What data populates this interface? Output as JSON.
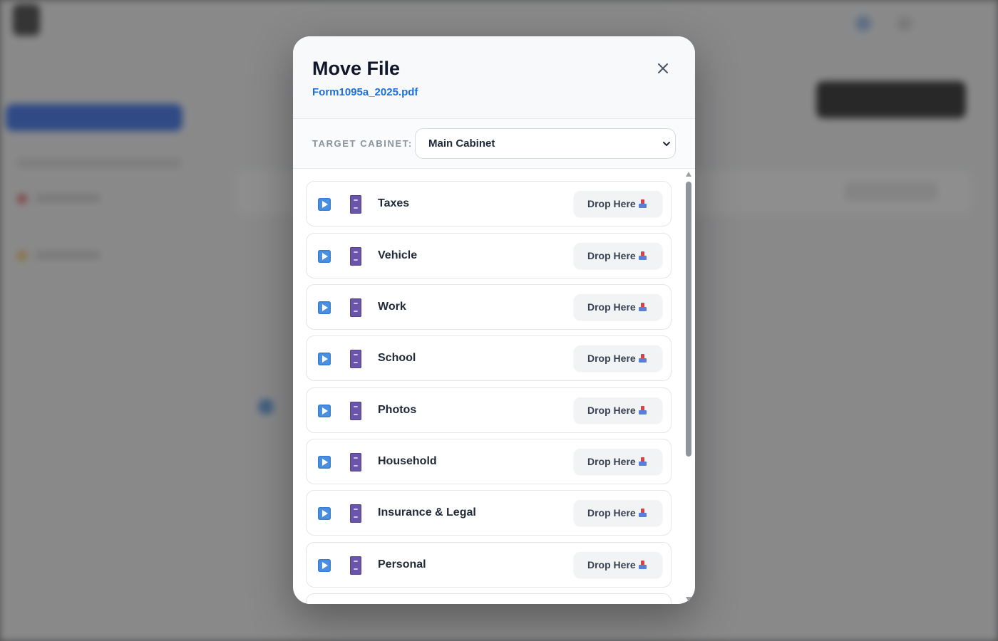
{
  "modal": {
    "title": "Move File",
    "file_name": "Form1095a_2025.pdf",
    "target_label": "TARGET CABINET:",
    "target_value": "Main Cabinet"
  },
  "cabinets": [
    {
      "name": "Taxes",
      "action": "Drop Here"
    },
    {
      "name": "Vehicle",
      "action": "Drop Here"
    },
    {
      "name": "Work",
      "action": "Drop Here"
    },
    {
      "name": "School",
      "action": "Drop Here"
    },
    {
      "name": "Photos",
      "action": "Drop Here"
    },
    {
      "name": "Household",
      "action": "Drop Here"
    },
    {
      "name": "Insurance & Legal",
      "action": "Drop Here"
    },
    {
      "name": "Personal",
      "action": "Drop Here"
    }
  ],
  "colors": {
    "accent_link": "#1a6fd8",
    "title": "#0f172a",
    "cabinet_icon": "#6a55a8",
    "play_icon": "#4a90e2"
  },
  "icons": {
    "close": "close-icon",
    "expand": "play-triangle-icon",
    "cabinet": "file-cabinet-icon",
    "drop": "inbox-tray-icon",
    "select": "chevron-down-icon"
  }
}
